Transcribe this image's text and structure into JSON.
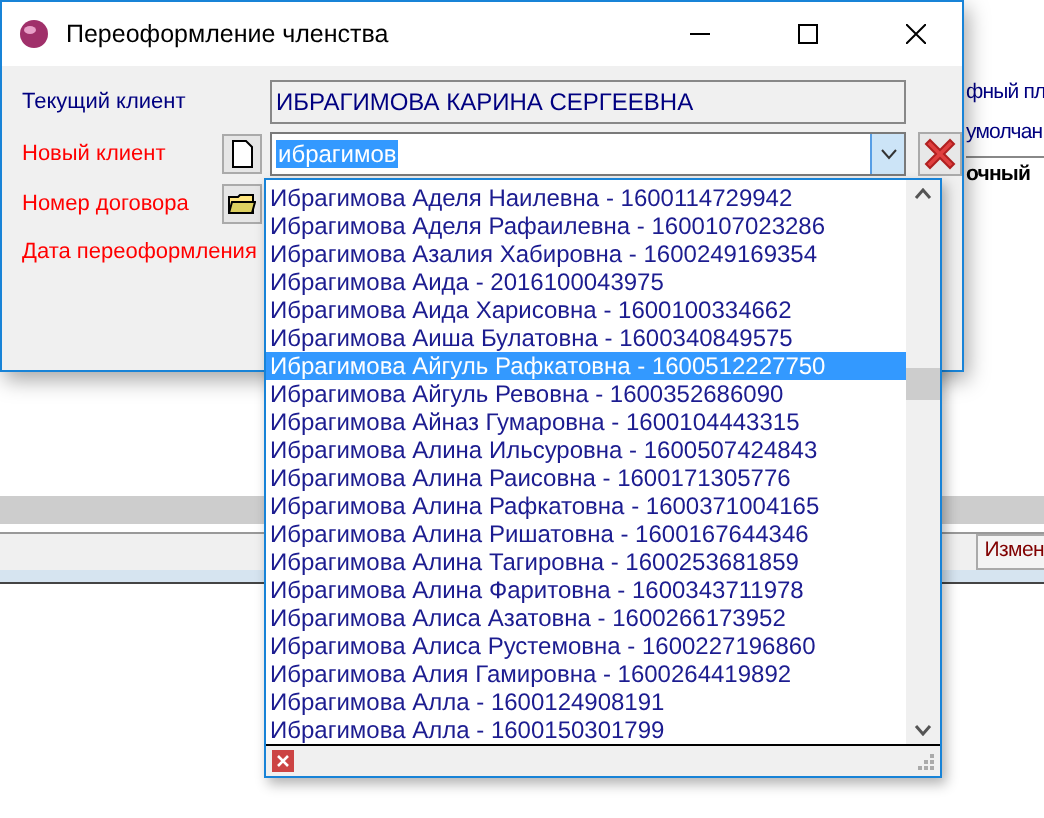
{
  "background_window": {
    "texts": [
      {
        "text": "фный пл",
        "bold": false
      },
      {
        "text": "умолчан",
        "bold": false
      },
      {
        "text": "очный",
        "bold": true
      }
    ],
    "field_label": "Измен"
  },
  "dialog": {
    "title": "Переоформление членства",
    "fields": [
      {
        "label": "Текущий клиент",
        "required": false,
        "kind": "readonly",
        "value": "ИБРАГИМОВА КАРИНА СЕРГЕЕВНА"
      },
      {
        "label": "Новый клиент",
        "required": true,
        "kind": "combo",
        "value": "ибрагимов"
      },
      {
        "label": "Номер договора",
        "required": true,
        "kind": "folder"
      },
      {
        "label": "Дата переоформления",
        "required": true,
        "kind": "plain"
      }
    ]
  },
  "dropdown": {
    "items": [
      {
        "text": "Ибрагимова Аделя Наилевна - 1600114729942",
        "selected": false
      },
      {
        "text": "Ибрагимова Аделя Рафаилевна - 1600107023286",
        "selected": false
      },
      {
        "text": "Ибрагимова Азалия Хабировна - 1600249169354",
        "selected": false
      },
      {
        "text": "Ибрагимова Аида - 2016100043975",
        "selected": false
      },
      {
        "text": "Ибрагимова Аида Харисовна - 1600100334662",
        "selected": false
      },
      {
        "text": "Ибрагимова Аиша Булатовна - 1600340849575",
        "selected": false
      },
      {
        "text": "Ибрагимова Айгуль Рафкатовна - 1600512227750",
        "selected": true
      },
      {
        "text": "Ибрагимова Айгуль Ревовна - 1600352686090",
        "selected": false
      },
      {
        "text": "Ибрагимова Айназ Гумаровна - 1600104443315",
        "selected": false
      },
      {
        "text": "Ибрагимова Алина Ильсуровна - 1600507424843",
        "selected": false
      },
      {
        "text": "Ибрагимова Алина Раисовна - 1600171305776",
        "selected": false
      },
      {
        "text": "Ибрагимова Алина Рафкатовна - 1600371004165",
        "selected": false
      },
      {
        "text": "Ибрагимова Алина Ришатовна - 1600167644346",
        "selected": false
      },
      {
        "text": "Ибрагимова Алина Тагировна - 1600253681859",
        "selected": false
      },
      {
        "text": "Ибрагимова Алина Фаритовна - 1600343711978",
        "selected": false
      },
      {
        "text": "Ибрагимова Алиса Азатовна - 1600266173952",
        "selected": false
      },
      {
        "text": "Ибрагимова Алиса Рустемовна - 1600227196860",
        "selected": false
      },
      {
        "text": "Ибрагимова Алия Гамировна - 1600264419892",
        "selected": false
      },
      {
        "text": "Ибрагимова Алла - 1600124908191",
        "selected": false
      },
      {
        "text": "Ибрагимова Алла - 1600150301799",
        "selected": false
      }
    ]
  }
}
